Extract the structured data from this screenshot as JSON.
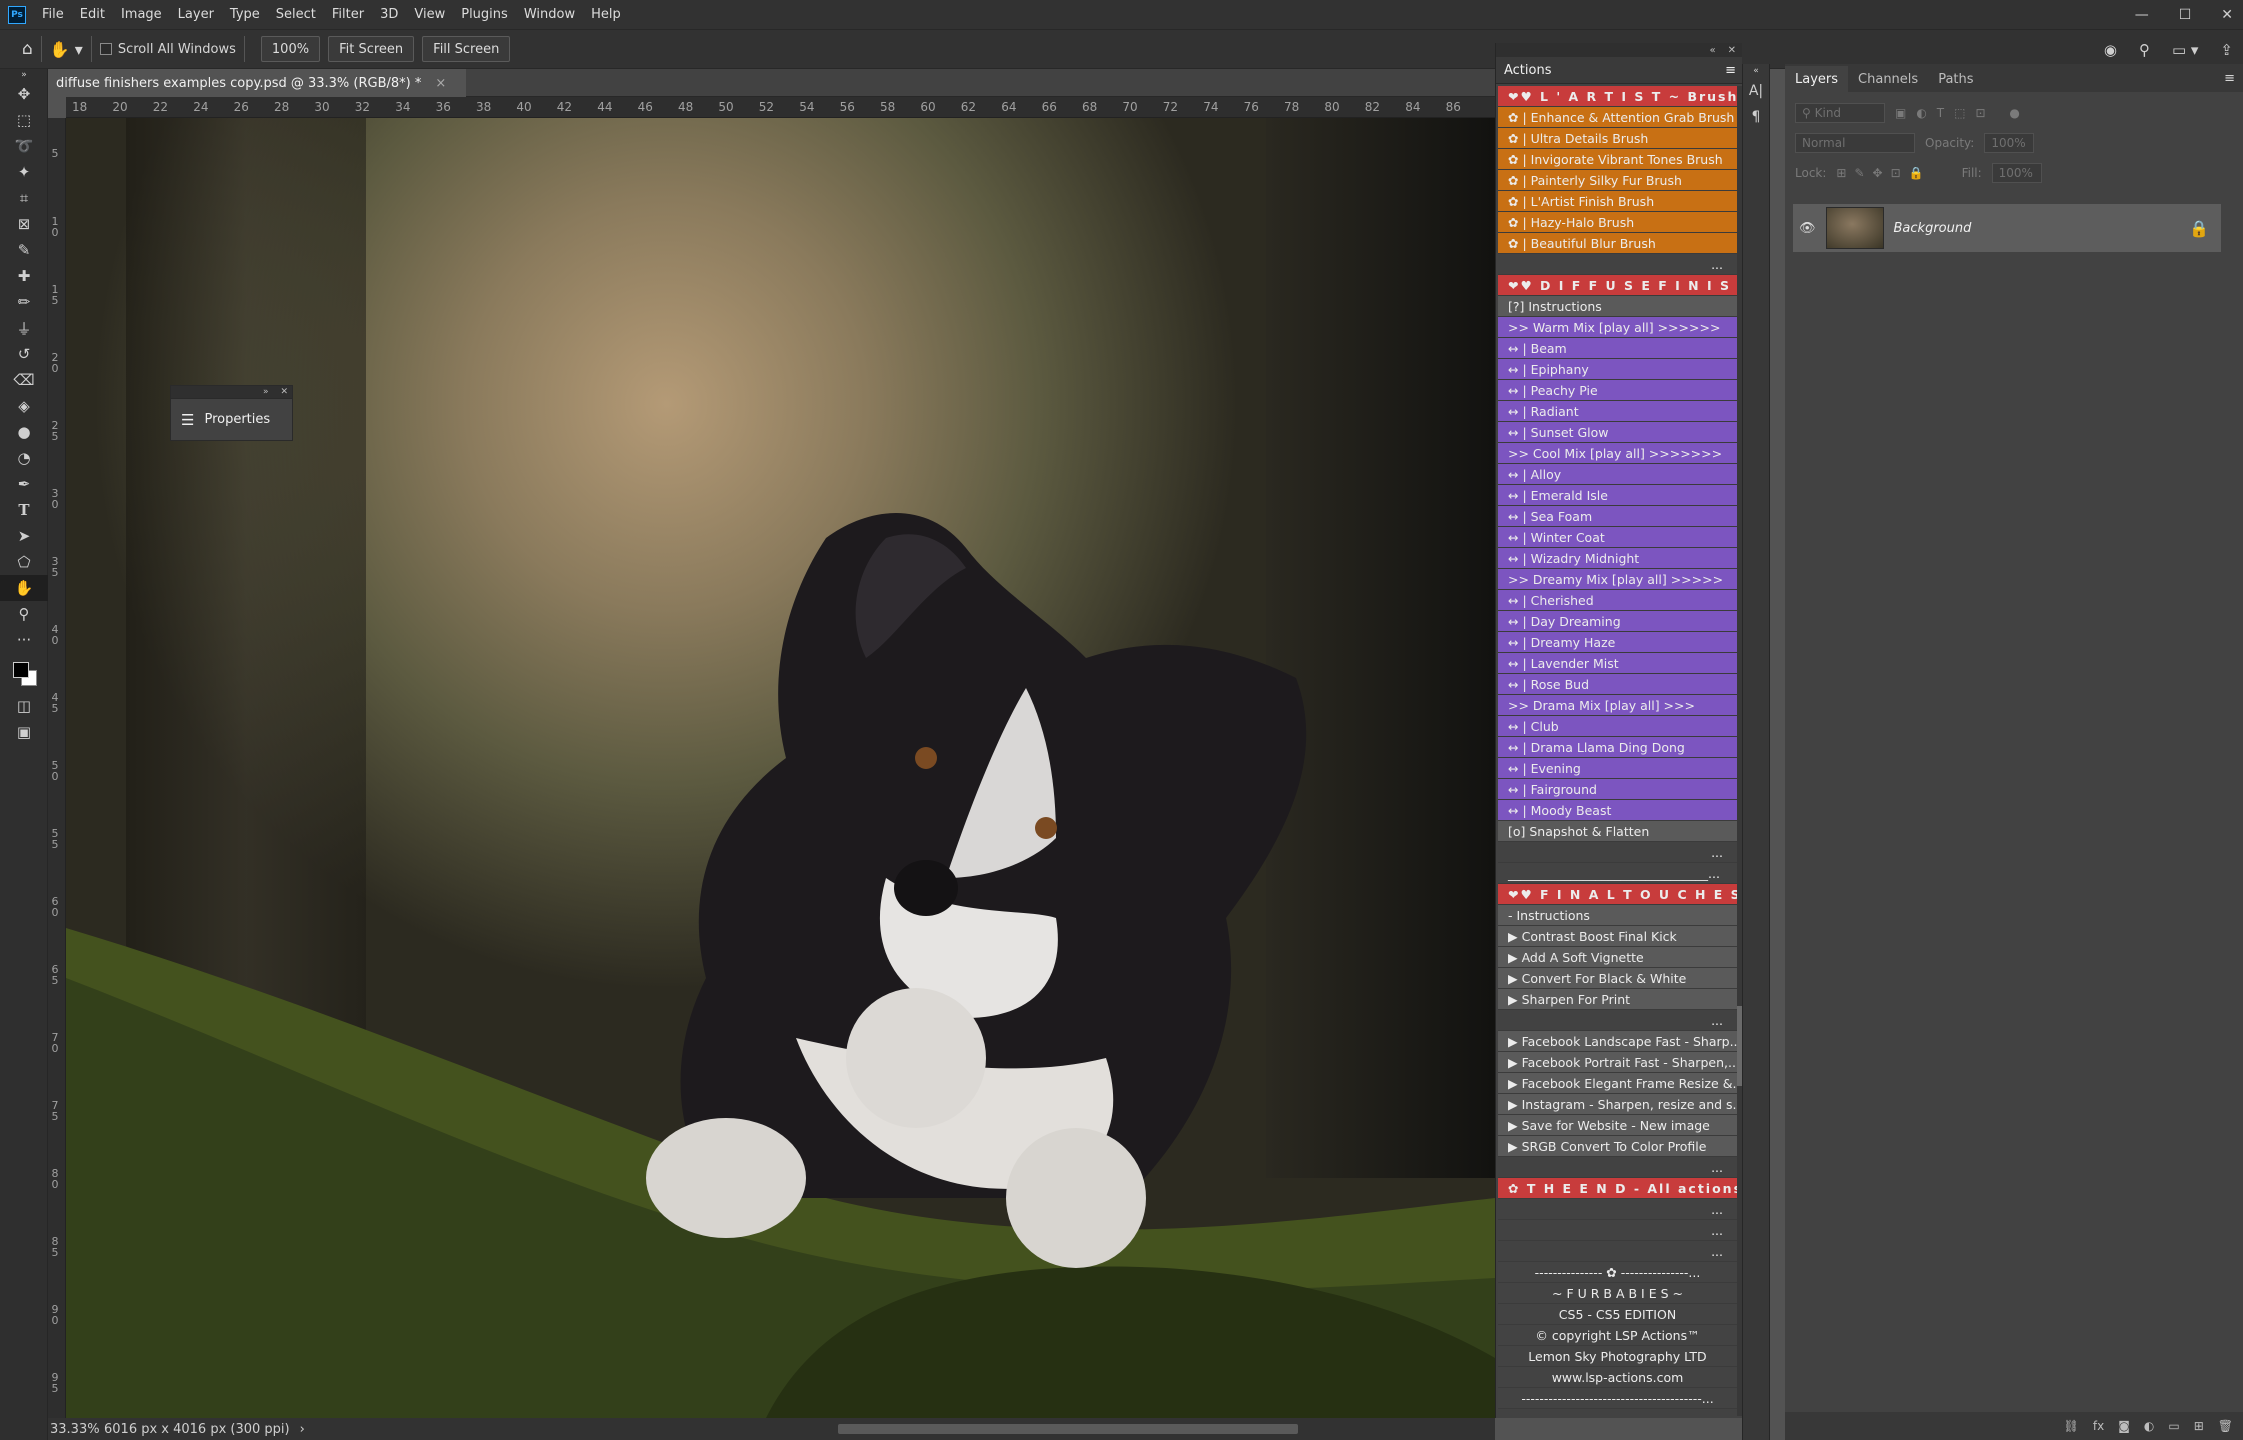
{
  "app": {
    "logo": "Ps"
  },
  "menubar": {
    "items": [
      "File",
      "Edit",
      "Image",
      "Layer",
      "Type",
      "Select",
      "Filter",
      "3D",
      "View",
      "Plugins",
      "Window",
      "Help"
    ]
  },
  "window_controls": {
    "minimize": "—",
    "maximize": "☐",
    "close": "✕"
  },
  "options": {
    "scroll_all_windows": "Scroll All Windows",
    "zoom": "100%",
    "fit_screen": "Fit Screen",
    "fill_screen": "Fill Screen"
  },
  "document": {
    "tab_title": "diffuse finishers examples copy.psd @ 33.3% (RGB/8*) *",
    "close": "×"
  },
  "ruler": {
    "h": [
      "18",
      "20",
      "22",
      "24",
      "26",
      "28",
      "30",
      "32",
      "34",
      "36",
      "38",
      "40",
      "42",
      "44",
      "46",
      "48",
      "50",
      "52",
      "54",
      "56",
      "58",
      "60",
      "62",
      "64",
      "66",
      "68",
      "70",
      "72",
      "74",
      "76",
      "78",
      "80",
      "82",
      "84",
      "86"
    ],
    "v": [
      "5",
      "1\n0",
      "1\n5",
      "2\n0",
      "2\n5",
      "3\n0",
      "3\n5",
      "4\n0",
      "4\n5",
      "5\n0",
      "5\n5",
      "6\n0",
      "6\n5",
      "7\n0",
      "7\n5",
      "8\n0",
      "8\n5",
      "9\n0",
      "9\n5"
    ]
  },
  "status": {
    "zoom": "33.33%",
    "dims": "6016 px x 4016 px (300 ppi)",
    "arrow": "›"
  },
  "properties": {
    "title": "Properties"
  },
  "actions": {
    "title": "Actions",
    "rows": [
      {
        "text": "❤♥  L ' A R T I S T  ~ Brushes",
        "style": "red"
      },
      {
        "text": "✿  |  Enhance & Attention Grab Brush",
        "style": "orange"
      },
      {
        "text": "✿  |  Ultra Details Brush",
        "style": "orange"
      },
      {
        "text": "✿  |  Invigorate Vibrant Tones Brush",
        "style": "orange"
      },
      {
        "text": "✿  |  Painterly Silky Fur Brush",
        "style": "orange"
      },
      {
        "text": "✿  |  L'Artist Finish Brush",
        "style": "orange"
      },
      {
        "text": "✿  |  Hazy-Halo Brush",
        "style": "orange"
      },
      {
        "text": "✿  |  Beautiful Blur Brush",
        "style": "orange"
      },
      {
        "text": "...",
        "style": "dots"
      },
      {
        "text": "❤♥  D I F F U S E   F I N I S H E R S ...",
        "style": "red"
      },
      {
        "text": "[?]   Instructions",
        "style": "gray"
      },
      {
        "text": ">> Warm Mix [play all] >>>>>>",
        "style": "purple"
      },
      {
        "text": "↔ |  Beam",
        "style": "purple"
      },
      {
        "text": "↔ |  Epiphany",
        "style": "purple"
      },
      {
        "text": "↔ |  Peachy Pie",
        "style": "purple"
      },
      {
        "text": "↔ |  Radiant",
        "style": "purple"
      },
      {
        "text": "↔ |  Sunset Glow",
        "style": "purple"
      },
      {
        "text": ">> Cool Mix [play all] >>>>>>>",
        "style": "purple"
      },
      {
        "text": "↔ |  Alloy",
        "style": "purple"
      },
      {
        "text": "↔ |  Emerald Isle",
        "style": "purple"
      },
      {
        "text": "↔ |  Sea Foam",
        "style": "purple"
      },
      {
        "text": "↔ |  Winter Coat",
        "style": "purple"
      },
      {
        "text": "↔ |  Wizadry Midnight",
        "style": "purple"
      },
      {
        "text": ">> Dreamy Mix [play all] >>>>>",
        "style": "purple"
      },
      {
        "text": "↔ |  Cherished",
        "style": "purple"
      },
      {
        "text": "↔ |  Day Dreaming",
        "style": "purple"
      },
      {
        "text": "↔ |  Dreamy Haze",
        "style": "purple"
      },
      {
        "text": "↔ |  Lavender Mist",
        "style": "purple"
      },
      {
        "text": "↔ |  Rose Bud",
        "style": "purple"
      },
      {
        "text": ">> Drama Mix [play all] >>>",
        "style": "purple"
      },
      {
        "text": "↔ |  Club",
        "style": "purple"
      },
      {
        "text": "↔ |  Drama Llama Ding Dong",
        "style": "purple"
      },
      {
        "text": "↔ |  Evening",
        "style": "purple"
      },
      {
        "text": "↔ |  Fairground",
        "style": "purple"
      },
      {
        "text": "↔ |  Moody Beast",
        "style": "purple"
      },
      {
        "text": "[o] Snapshot & Flatten",
        "style": "gray"
      },
      {
        "text": "...",
        "style": "dots"
      },
      {
        "text": "________________________________...",
        "style": "dark"
      },
      {
        "text": "❤♥  F I N A L   T O U C H E S",
        "style": "red"
      },
      {
        "text": "- Instructions",
        "style": "gray"
      },
      {
        "text": "▶  Contrast Boost Final Kick",
        "style": "gray"
      },
      {
        "text": "▶  Add A Soft Vignette",
        "style": "gray"
      },
      {
        "text": "▶  Convert For Black & White",
        "style": "gray"
      },
      {
        "text": "▶  Sharpen For Print",
        "style": "gray"
      },
      {
        "text": "...",
        "style": "dots"
      },
      {
        "text": "▶  Facebook Landscape Fast - Sharp...",
        "style": "gray"
      },
      {
        "text": "▶  Facebook Portrait Fast - Sharpen,...",
        "style": "gray"
      },
      {
        "text": "▶  Facebook Elegant Frame Resize &...",
        "style": "gray"
      },
      {
        "text": "▶  Instagram - Sharpen, resize and s...",
        "style": "gray"
      },
      {
        "text": "▶  Save for Website - New image",
        "style": "gray"
      },
      {
        "text": "▶  SRGB Convert To Color Profile",
        "style": "gray"
      },
      {
        "text": "...",
        "style": "dots"
      },
      {
        "text": "✿ T H E  E N D - All actions © LSP ...",
        "style": "red"
      },
      {
        "text": "...",
        "style": "dots"
      },
      {
        "text": "...",
        "style": "dots"
      },
      {
        "text": "...",
        "style": "dots"
      },
      {
        "text": "---------------  ✿  ---------------...",
        "style": "dark center"
      },
      {
        "text": "~ F U R  B A B I E S ~",
        "style": "dark center"
      },
      {
        "text": "CS5 - CS5 EDITION",
        "style": "dark center"
      },
      {
        "text": "© copyright LSP Actions™",
        "style": "dark center"
      },
      {
        "text": "Lemon Sky Photography LTD",
        "style": "dark center"
      },
      {
        "text": "www.lsp-actions.com",
        "style": "dark center"
      },
      {
        "text": "----------------------------------------...",
        "style": "dark center"
      }
    ]
  },
  "layers": {
    "tabs": [
      "Layers",
      "Channels",
      "Paths"
    ],
    "kind": "Kind",
    "blend": "Normal",
    "opacity_label": "Opacity:",
    "opacity": "100%",
    "lock_label": "Lock:",
    "fill_label": "Fill:",
    "fill": "100%",
    "layer_name": "Background"
  }
}
